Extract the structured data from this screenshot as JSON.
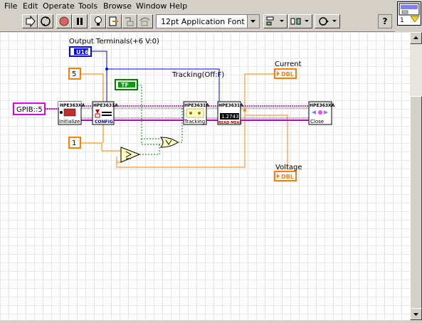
{
  "menu": {
    "file": "File",
    "edit": "Edit",
    "operate": "Operate",
    "tools": "Tools",
    "browse": "Browse",
    "window": "Window",
    "help": "Help"
  },
  "toolbar": {
    "font": "12pt Application Font",
    "help_label": "?"
  },
  "vi_icon": {
    "number": "1"
  },
  "diagram": {
    "output_terminals_label": "Output Terminals(+6 V:0)",
    "u16_label": "U16",
    "tracking_label": "Tracking(Off:F)",
    "current_label": "Current",
    "voltage_label": "Voltage",
    "dbl_label": "DBL",
    "tf_label": "TF",
    "gpib_label": "GPIB::5",
    "const_5": "5",
    "const_1": "1",
    "vi_header": "HPE363XA",
    "vi_header_config": "HPE3631A",
    "initialize_label": "Initialize",
    "config_label": "CONFIG",
    "tracking_vi_label": "Tracking",
    "read_meas_label": "READ MEAS",
    "close_label": "Close",
    "readout": "1.2743"
  },
  "colors": {
    "visa_wire": "#c000c0",
    "numeric_wire": "#ff8000",
    "int_wire": "#0000ff",
    "bool_wire": "#008000"
  }
}
